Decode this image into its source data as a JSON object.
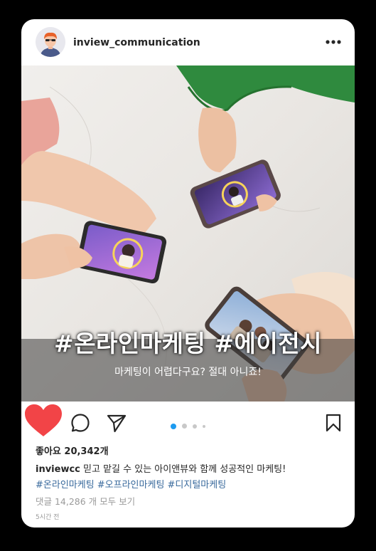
{
  "post": {
    "username": "inview_communication",
    "image": {
      "hashtag_title": "#온라인마케팅 #에이전시",
      "subtitle": "마케팅이 어렵다구요? 절대 아니죠!"
    },
    "carousel": {
      "total": 4,
      "active": 1
    },
    "likes_text": "좋아요 20,342개",
    "caption": {
      "author": "inviewcc",
      "text": "믿고 맡길 수 있는 아이앤뷰와 함께 성공적인 마케팅!"
    },
    "hashtags": "#온라인마케팅 #오프라인마케팅 #디지털마케팅",
    "comments_link": "댓글 14,286 개 모두 보기",
    "time_ago": "5시간 전"
  },
  "colors": {
    "heart": "#f24447",
    "dot_active": "#1d9bf0",
    "hashtag": "#38699c",
    "muted": "#9a9a9a"
  },
  "icons": [
    "more-icon",
    "heart-icon",
    "comment-icon",
    "share-icon",
    "bookmark-icon"
  ]
}
